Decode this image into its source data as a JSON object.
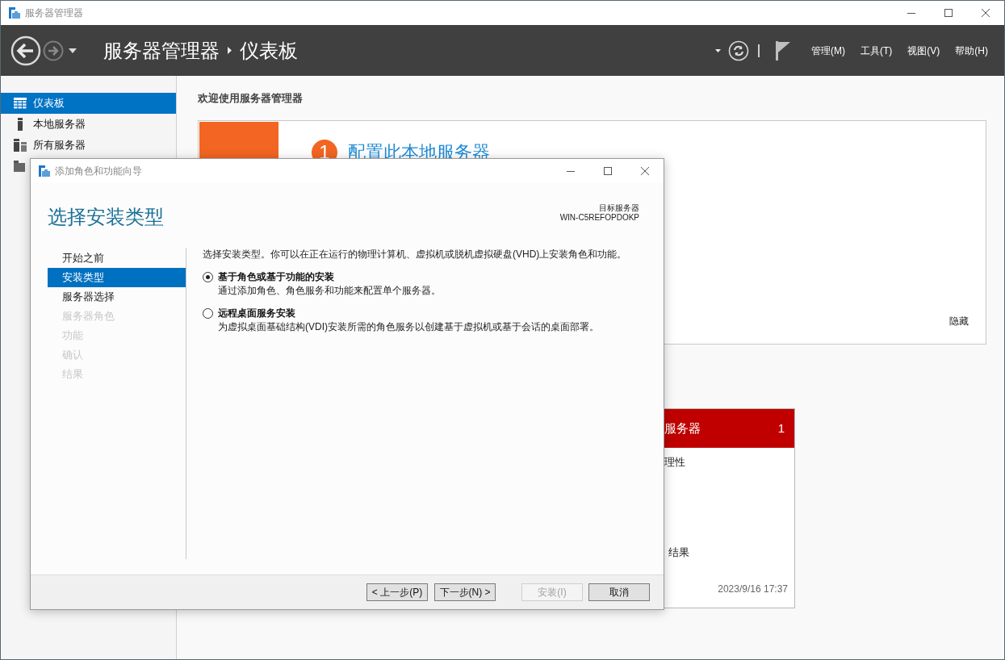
{
  "window": {
    "title": "服务器管理器"
  },
  "header": {
    "breadcrumb": [
      "服务器管理器",
      "仪表板"
    ],
    "menus": [
      "管理(M)",
      "工具(T)",
      "视图(V)",
      "帮助(H)"
    ]
  },
  "sidebar": {
    "items": [
      {
        "label": "仪表板",
        "kind": "grid",
        "selected": true
      },
      {
        "label": "本地服务器",
        "kind": "server",
        "selected": false
      },
      {
        "label": "所有服务器",
        "kind": "servers",
        "selected": false
      },
      {
        "kind": "group",
        "selected": false
      }
    ]
  },
  "welcome": {
    "title": "欢迎使用服务器管理器",
    "step_number": "1",
    "step_title": "配置此本地服务器",
    "hide_link": "隐藏"
  },
  "server_tile": {
    "title": "服务器",
    "count": "1",
    "items": [
      "理性",
      "结果"
    ],
    "timestamp": "2023/9/16 17:37"
  },
  "dialog": {
    "title": "添加角色和功能向导",
    "heading": "选择安装类型",
    "target_label": "目标服务器",
    "target_server": "WIN-C5REFOPDOKP",
    "steps": [
      {
        "label": "开始之前",
        "selected": false,
        "disabled": false
      },
      {
        "label": "安装类型",
        "selected": true,
        "disabled": false
      },
      {
        "label": "服务器选择",
        "selected": false,
        "disabled": false
      },
      {
        "label": "服务器角色",
        "selected": false,
        "disabled": true
      },
      {
        "label": "功能",
        "selected": false,
        "disabled": true
      },
      {
        "label": "确认",
        "selected": false,
        "disabled": true
      },
      {
        "label": "结果",
        "selected": false,
        "disabled": true
      }
    ],
    "intro": "选择安装类型。你可以在正在运行的物理计算机、虚拟机或脱机虚拟硬盘(VHD)上安装角色和功能。",
    "options": [
      {
        "title": "基于角色或基于功能的安装",
        "description": "通过添加角色、角色服务和功能来配置单个服务器。",
        "selected": true
      },
      {
        "title": "远程桌面服务安装",
        "description": "为虚拟桌面基础结构(VDI)安装所需的角色服务以创建基于虚拟机或基于会话的桌面部署。",
        "selected": false
      }
    ],
    "buttons": [
      {
        "label": "< 上一步(P)",
        "disabled": false
      },
      {
        "label": "下一步(N) >",
        "disabled": false
      },
      {
        "label": "安装(I)",
        "disabled": true
      },
      {
        "label": "取消",
        "disabled": false
      }
    ]
  }
}
